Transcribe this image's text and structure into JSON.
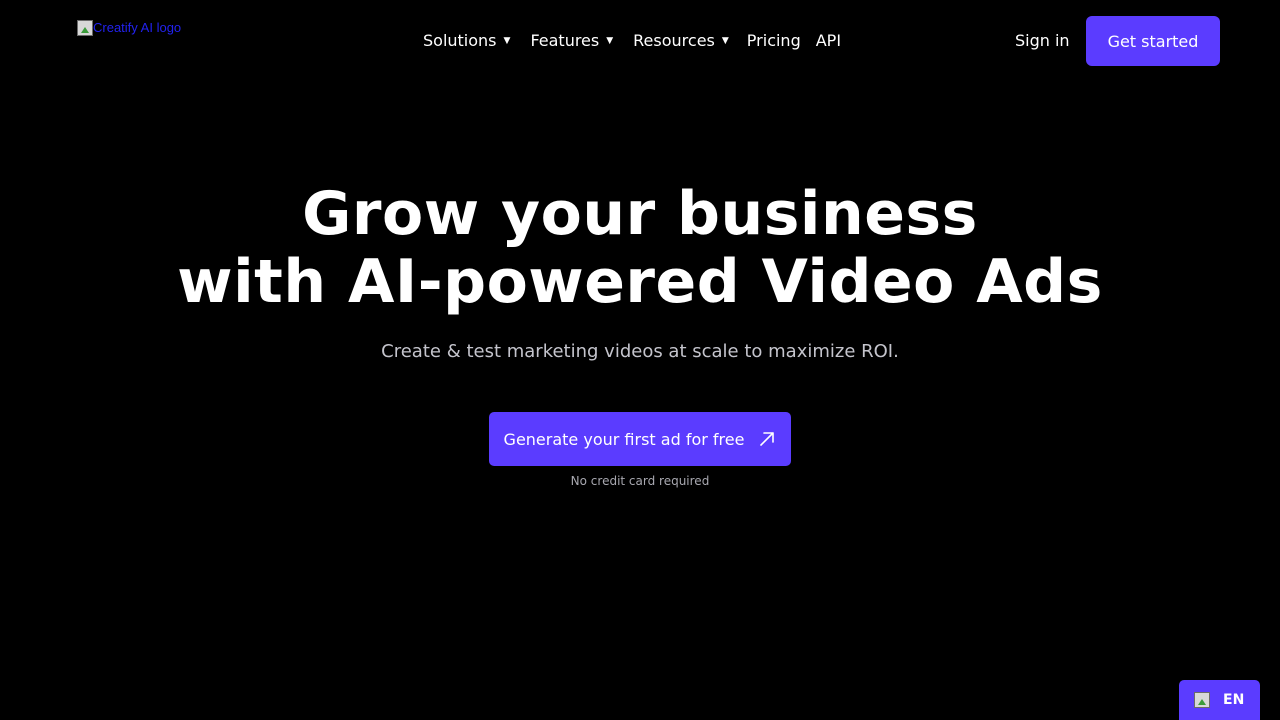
{
  "header": {
    "logo_alt": "Creatify AI logo",
    "nav": [
      {
        "label": "Solutions",
        "has_dropdown": true
      },
      {
        "label": "Features",
        "has_dropdown": true
      },
      {
        "label": "Resources",
        "has_dropdown": true
      },
      {
        "label": "Pricing",
        "has_dropdown": false
      },
      {
        "label": "API",
        "has_dropdown": false
      }
    ],
    "sign_in": "Sign in",
    "get_started": "Get started"
  },
  "hero": {
    "title_line1": "Grow your business",
    "title_line2": "with AI-powered Video Ads",
    "subtitle": "Create & test marketing videos at scale to maximize ROI.",
    "cta_label": "Generate your first ad for free",
    "cta_icon": "arrow-up-right-icon",
    "note": "No credit card required"
  },
  "language": {
    "code": "EN",
    "icon": "flag-icon"
  },
  "colors": {
    "background": "#000000",
    "accent": "#5b3cff",
    "subtitle": "#c4c4cc"
  }
}
